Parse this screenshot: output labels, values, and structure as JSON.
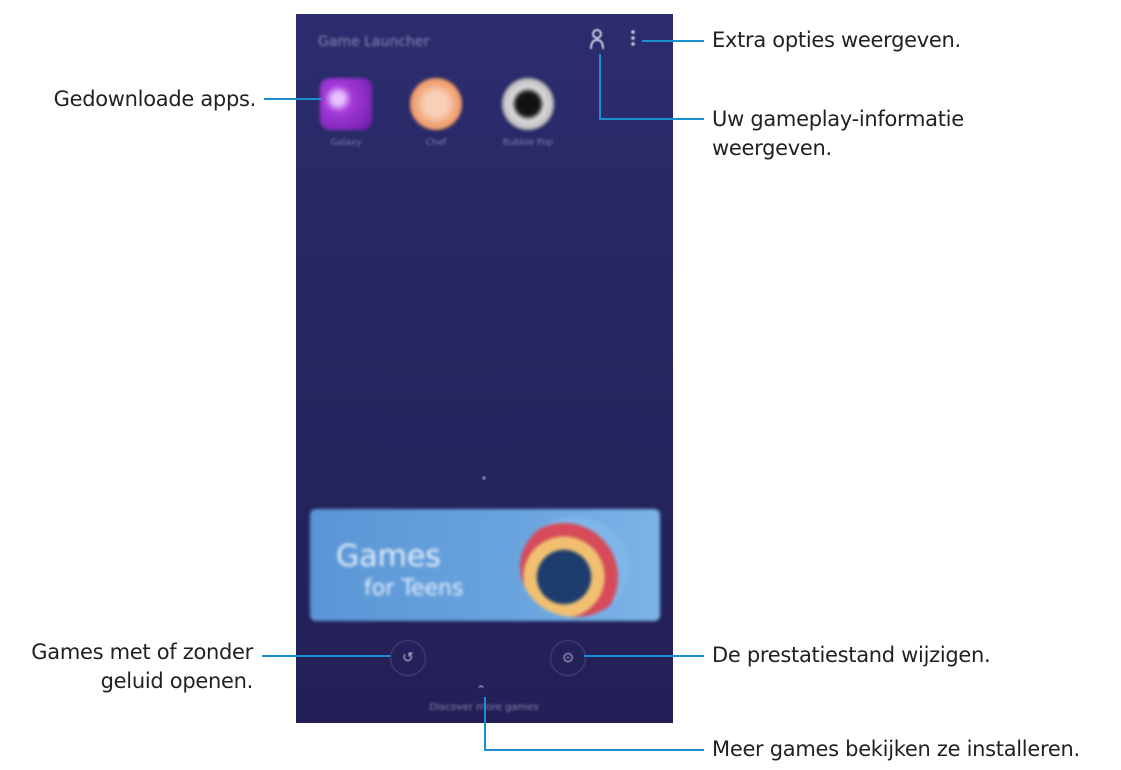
{
  "phone": {
    "app_title": "Game Launcher",
    "top_icons": {
      "profile": "person-icon",
      "more": "more-vert-icon"
    },
    "apps": [
      {
        "label": "Galaxy"
      },
      {
        "label": "Chef"
      },
      {
        "label": "Bubble Pop"
      }
    ],
    "banner": {
      "line1": "Games",
      "line2": "for Teens"
    },
    "sound_button_glyph": "↺",
    "performance_button_glyph": "⊙",
    "bottom_arrow_glyph": "⌃",
    "bottom_label": "Discover more games"
  },
  "callouts": {
    "more_options": "Extra opties weergeven.",
    "gameplay_info_line1": "Uw gameplay-informatie",
    "gameplay_info_line2": "weergeven.",
    "downloaded_apps": "Gedownloade apps.",
    "sound_line1": "Games met of zonder",
    "sound_line2": "geluid openen.",
    "performance_mode": "De prestatiestand wijzigen.",
    "more_games": "Meer games bekijken ze installeren."
  },
  "colors": {
    "callout_line": "#1a8fd0",
    "phone_background": "#262660"
  }
}
